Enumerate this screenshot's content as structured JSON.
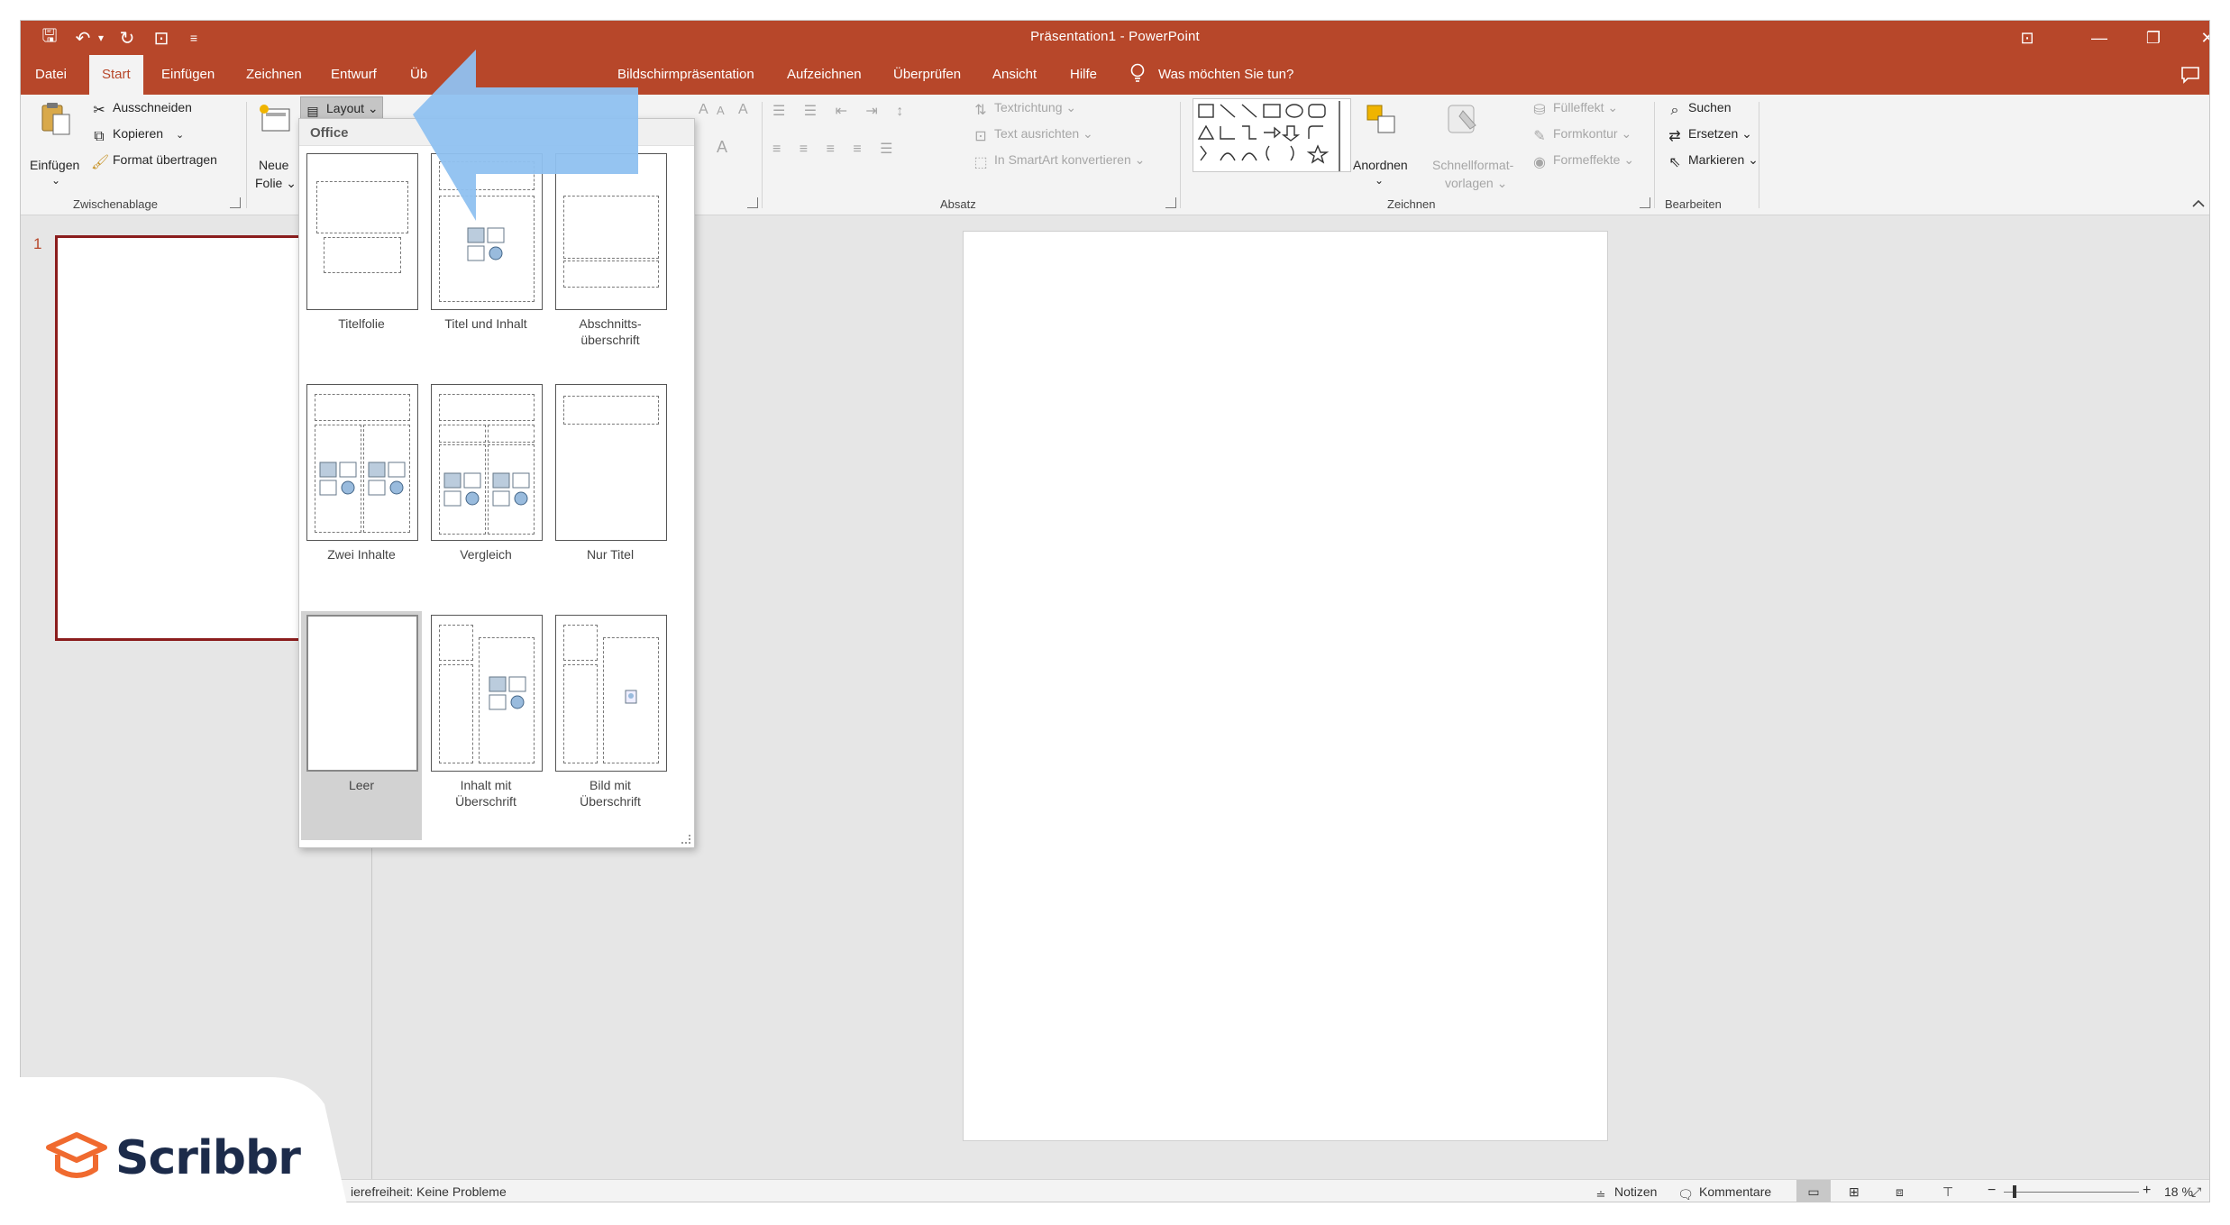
{
  "window": {
    "title": "Präsentation1  -  PowerPoint",
    "controls": {
      "ribbon_display": "⊡",
      "minimize": "—",
      "restore": "❐",
      "close": "✕"
    }
  },
  "qat": {
    "save": "🖫",
    "undo": "↶",
    "undo_dd": "▾",
    "redo": "↻",
    "present": "⊡",
    "customize": "≡"
  },
  "tabs": {
    "items": [
      "Datei",
      "Start",
      "Einfügen",
      "Zeichnen",
      "Entwurf",
      "Üb",
      "Bildschirmpräsentation",
      "Aufzeichnen",
      "Überprüfen",
      "Ansicht",
      "Hilfe"
    ],
    "active": "Start",
    "tell_me": "Was möchten Sie tun?"
  },
  "ribbon": {
    "clipboard": {
      "paste": "Einfügen",
      "paste_dd": "⌄",
      "cut": "Ausschneiden",
      "copy": "Kopieren",
      "copy_dd": "⌄",
      "format_painter": "Format übertragen",
      "label": "Zwischenablage"
    },
    "slides": {
      "new_slide_line1": "Neue",
      "new_slide_line2": "Folie ⌄",
      "layout": "Layout ⌄"
    },
    "font": {
      "grow": "A",
      "shrink": "A",
      "clear": "A"
    },
    "paragraph": {
      "text_direction": "Textrichtung ⌄",
      "align_text": "Text ausrichten ⌄",
      "smartart": "In SmartArt konvertieren ⌄",
      "label": "Absatz"
    },
    "drawing": {
      "arrange_line1": "Anordnen",
      "arrange_line2": "⌄",
      "quick_styles_line1": "Schnellformat-",
      "quick_styles_line2": "vorlagen ⌄",
      "fill": "Fülleffekt ⌄",
      "outline": "Formkontur ⌄",
      "effects": "Formeffekte ⌄",
      "label": "Zeichnen"
    },
    "editing": {
      "find": "Suchen",
      "replace": "Ersetzen  ⌄",
      "select": "Markieren ⌄",
      "label": "Bearbeiten"
    }
  },
  "thumbnails": {
    "slide_number": "1"
  },
  "layout_dropdown": {
    "header": "Office",
    "layouts": [
      {
        "label": "Titelfolie"
      },
      {
        "label": "Titel und Inhalt"
      },
      {
        "label": "Abschnitts-\nüberschrift"
      },
      {
        "label": "Zwei Inhalte"
      },
      {
        "label": "Vergleich"
      },
      {
        "label": "Nur Titel"
      },
      {
        "label": "Leer"
      },
      {
        "label": "Inhalt mit\nÜberschrift"
      },
      {
        "label": "Bild mit\nÜberschrift"
      }
    ],
    "selected": "Leer"
  },
  "status_bar": {
    "accessibility": "ierefreiheit: Keine Probleme",
    "notes": "Notizen",
    "comments": "Kommentare",
    "zoom_minus": "−",
    "zoom_plus": "+",
    "zoom": "18 %"
  },
  "overlay": {
    "brand": "Scribbr",
    "arrow_color": "#8fc1f0"
  },
  "colors": {
    "accent": "#b7472a",
    "selection_border": "#8b1d1d"
  }
}
